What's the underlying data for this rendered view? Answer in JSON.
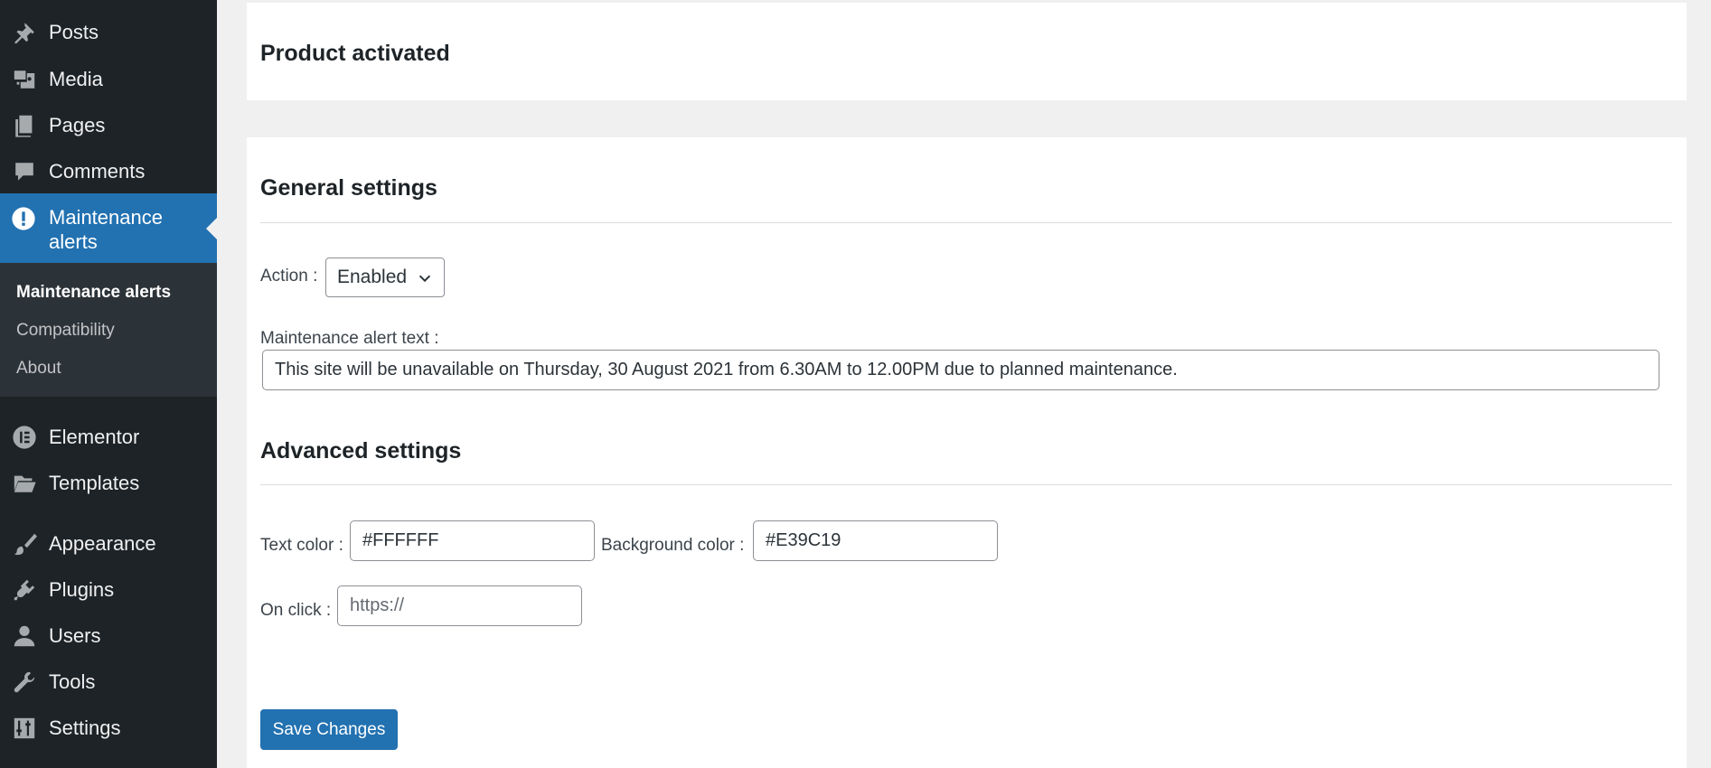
{
  "sidebar": {
    "items_top": [
      {
        "label": "Posts",
        "icon": "pin-icon"
      },
      {
        "label": "Media",
        "icon": "media-icon"
      },
      {
        "label": "Pages",
        "icon": "pages-icon"
      },
      {
        "label": "Comments",
        "icon": "comment-icon"
      }
    ],
    "active": {
      "label": "Maintenance alerts",
      "icon": "alert-icon"
    },
    "submenu": [
      {
        "label": "Maintenance alerts",
        "current": true
      },
      {
        "label": "Compatibility",
        "current": false
      },
      {
        "label": "About",
        "current": false
      }
    ],
    "items_bottom": [
      {
        "label": "Elementor",
        "icon": "elementor-icon"
      },
      {
        "label": "Templates",
        "icon": "folder-icon"
      },
      {
        "label": "Appearance",
        "icon": "brush-icon"
      },
      {
        "label": "Plugins",
        "icon": "plugin-icon"
      },
      {
        "label": "Users",
        "icon": "user-icon"
      },
      {
        "label": "Tools",
        "icon": "wrench-icon"
      },
      {
        "label": "Settings",
        "icon": "settings-icon"
      }
    ]
  },
  "status": {
    "title": "Product activated"
  },
  "general": {
    "title": "General settings",
    "action_label": "Action :",
    "action_value": "Enabled",
    "alert_text_label": "Maintenance alert text :",
    "alert_text_value": "This site will be unavailable on Thursday, 30 August 2021 from 6.30AM to 12.00PM due to planned maintenance."
  },
  "advanced": {
    "title": "Advanced settings",
    "text_color_label": "Text color :",
    "text_color_value": "#FFFFFF",
    "bg_color_label": "Background color :",
    "bg_color_value": "#E39C19",
    "onclick_label": "On click :",
    "onclick_placeholder": "https://"
  },
  "save_label": "Save Changes",
  "colors": {
    "sidebar_bg": "#1d2327",
    "submenu_bg": "#2c3338",
    "accent": "#2271b1",
    "page_bg": "#f0f0f1"
  }
}
